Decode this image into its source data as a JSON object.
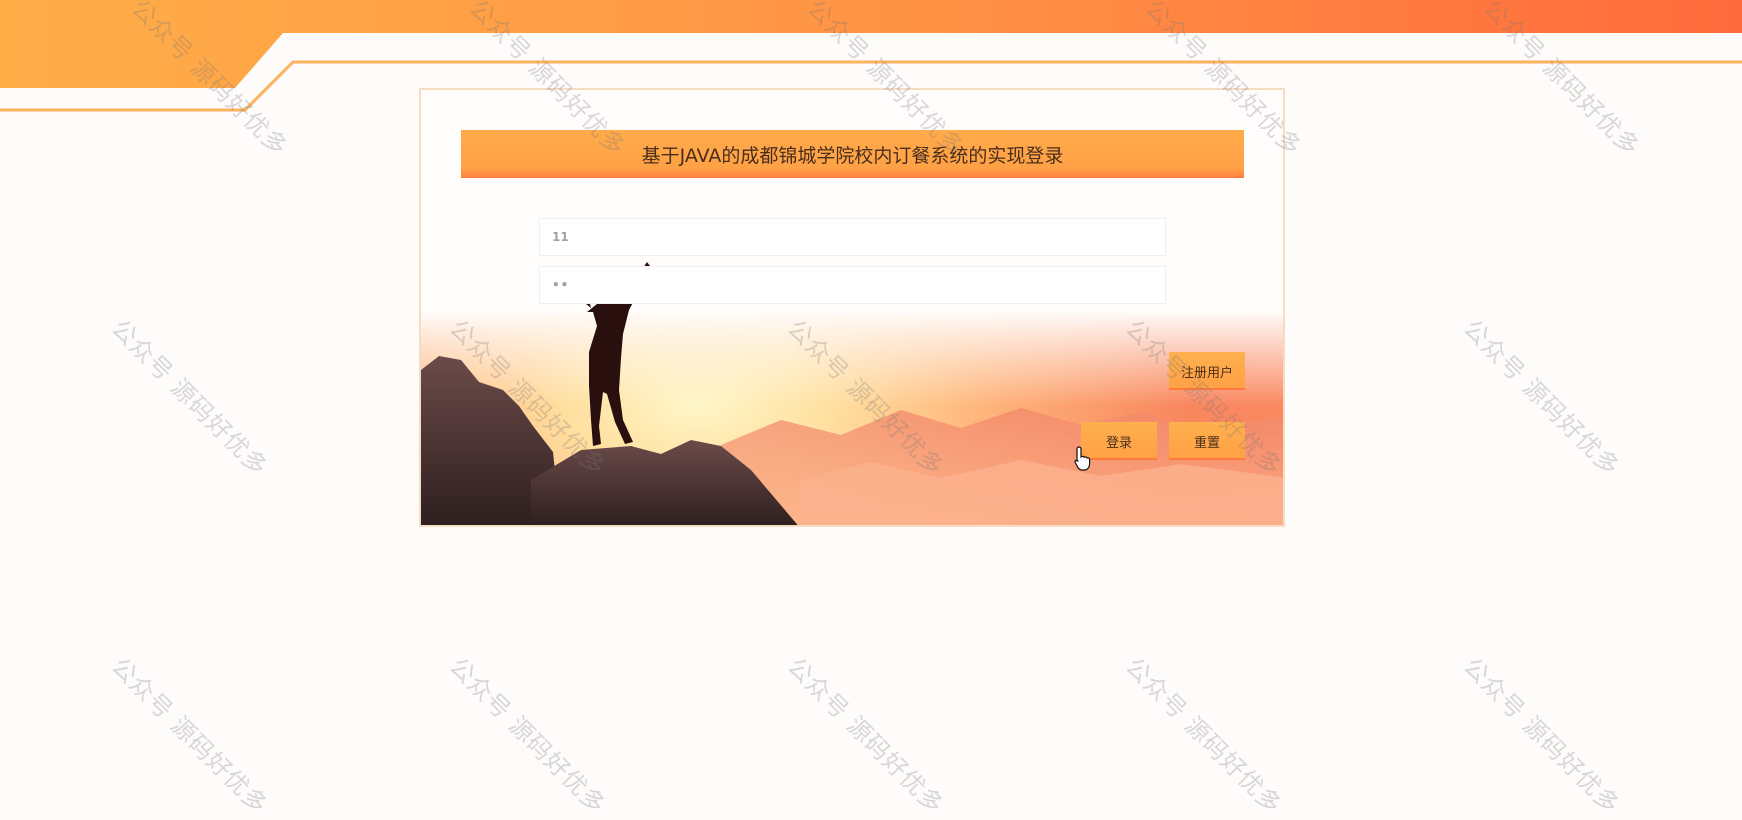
{
  "login": {
    "title": "基于JAVA的成都锦城学院校内订餐系统的实现登录",
    "username_value": "11",
    "password_value": "••",
    "register_label": "注册用户",
    "login_label": "登录",
    "reset_label": "重置"
  },
  "watermark": {
    "text": "公众号 源码好优多"
  },
  "colors": {
    "accent": "#ffa446",
    "accent_deep": "#ff6a3c",
    "title_text": "#4a2e1c",
    "panel_border": "#f6dcc0"
  },
  "icons": {
    "cursor": "hand-pointer-icon"
  }
}
